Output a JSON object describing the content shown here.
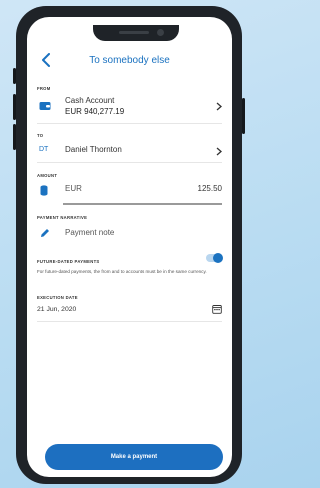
{
  "header": {
    "title": "To somebody else"
  },
  "from": {
    "label": "FROM",
    "account_name": "Cash Account",
    "amount": "EUR 940,277.19"
  },
  "to": {
    "label": "TO",
    "initials": "DT",
    "name": "Daniel Thornton"
  },
  "amount": {
    "label": "AMOUNT",
    "currency": "EUR",
    "value": "125.50"
  },
  "narrative": {
    "label": "PAYMENT NARRATIVE",
    "placeholder": "Payment note"
  },
  "future": {
    "label": "FUTURE-DATED PAYMENTS",
    "enabled": true,
    "help_text": "For future-dated payments, the from and to accounts must be in the same currency."
  },
  "execution": {
    "label": "EXECUTION DATE",
    "date": "21 Jun, 2020"
  },
  "cta": {
    "label": "Make a payment"
  },
  "colors": {
    "accent": "#1b72c0",
    "button": "#1d6fc0",
    "background": "#bfe0f4"
  }
}
